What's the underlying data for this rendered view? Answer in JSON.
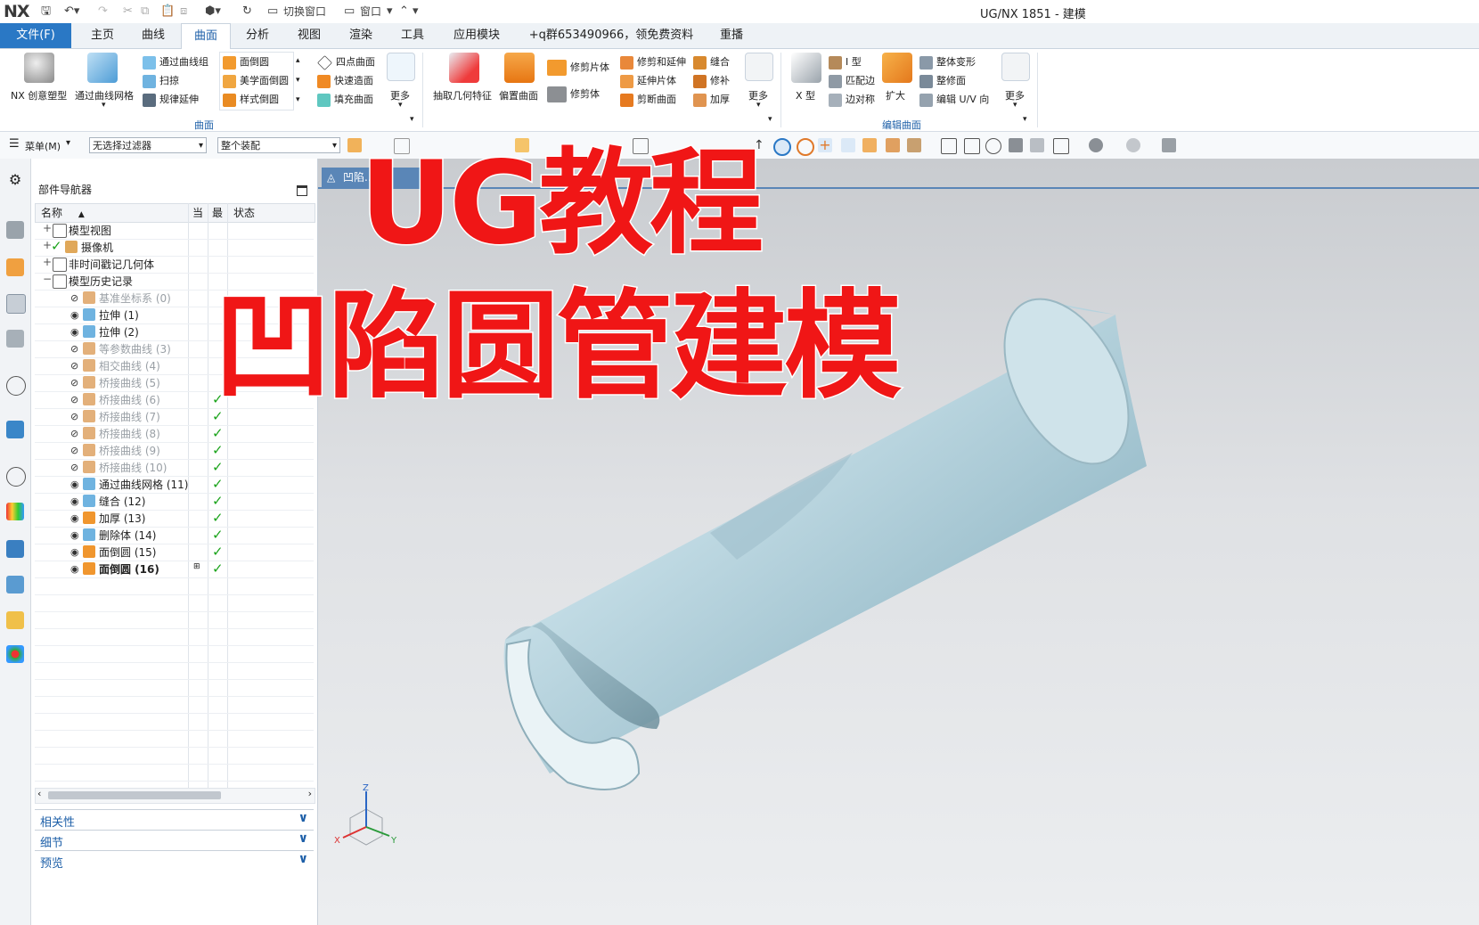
{
  "titlebar": {
    "logo": "NX",
    "switch_window": "切换窗口",
    "window_menu": "窗口",
    "title": "UG/NX 1851 - 建模"
  },
  "tabs": [
    "文件(F)",
    "主页",
    "曲线",
    "曲面",
    "分析",
    "视图",
    "渲染",
    "工具",
    "应用模块",
    "+q群653490966，领免费资料",
    "重播"
  ],
  "ribbon": {
    "surface_group": {
      "creative_modeling": "NX 创意塑型",
      "through_curve_mesh": "通过曲线网格",
      "through_curves": "通过曲线组",
      "sweep": "扫掠",
      "ruled": "规律延伸",
      "face_blend": "面倒圆",
      "aesthetic_blend": "美学面倒圆",
      "styled_blend": "样式倒圆",
      "four_point": "四点曲面",
      "quick_surface": "快速造面",
      "fill_surface": "填充曲面",
      "more": "更多",
      "label": "曲面"
    },
    "ops_group": {
      "extract_geometry": "抽取几何特征",
      "offset_surface": "偏置曲面",
      "trim_sheet": "修剪片体",
      "trim_body": "修剪体",
      "trim_extend": "修剪和延伸",
      "extend_sheet": "延伸片体",
      "split_surface": "剪断曲面",
      "sew": "缝合",
      "patch": "修补",
      "thicken": "加厚",
      "more": "更多"
    },
    "edit_group": {
      "x_form": "X 型",
      "i_form": "I 型",
      "match_edge": "匹配边",
      "edge_symmetry": "边对称",
      "enlarge": "扩大",
      "global_shaping": "整体变形",
      "refit": "整修面",
      "edit_uv": "编辑 U/V 向",
      "more": "更多",
      "label": "编辑曲面"
    }
  },
  "filterbar": {
    "menu": "菜单(M)",
    "filter": "无选择过滤器",
    "scope": "整个装配"
  },
  "navigator": {
    "title": "部件导航器",
    "columns": [
      "名称",
      "当",
      "最",
      "状态"
    ],
    "rows": [
      {
        "label": "模型视图",
        "style": "normal",
        "check": false
      },
      {
        "label": "摄像机",
        "style": "normal",
        "check": false
      },
      {
        "label": "非时间戳记几何体",
        "style": "normal",
        "check": false
      },
      {
        "label": "模型历史记录",
        "style": "normal",
        "check": false
      },
      {
        "label": "基准坐标系 (0)",
        "style": "grey",
        "check": false
      },
      {
        "label": "拉伸 (1)",
        "style": "normal",
        "check": false
      },
      {
        "label": "拉伸 (2)",
        "style": "normal",
        "check": false
      },
      {
        "label": "等参数曲线 (3)",
        "style": "grey",
        "check": false
      },
      {
        "label": "相交曲线 (4)",
        "style": "grey",
        "check": false
      },
      {
        "label": "桥接曲线 (5)",
        "style": "grey",
        "check": false
      },
      {
        "label": "桥接曲线 (6)",
        "style": "grey",
        "check": true
      },
      {
        "label": "桥接曲线 (7)",
        "style": "grey",
        "check": true
      },
      {
        "label": "桥接曲线 (8)",
        "style": "grey",
        "check": true
      },
      {
        "label": "桥接曲线 (9)",
        "style": "grey",
        "check": true
      },
      {
        "label": "桥接曲线 (10)",
        "style": "grey",
        "check": true
      },
      {
        "label": "通过曲线网格 (11)",
        "style": "normal",
        "check": true
      },
      {
        "label": "缝合 (12)",
        "style": "normal",
        "check": true
      },
      {
        "label": "加厚 (13)",
        "style": "normal",
        "check": true
      },
      {
        "label": "删除体 (14)",
        "style": "normal",
        "check": true
      },
      {
        "label": "面倒圆 (15)",
        "style": "normal",
        "check": true
      },
      {
        "label": "面倒圆 (16)",
        "style": "bold",
        "check": true
      }
    ],
    "panels": [
      "相关性",
      "细节",
      "预览"
    ]
  },
  "viewport": {
    "tab_label": "凹陷...rt",
    "overlay_line1": "UG教程",
    "overlay_line2": "凹陷圆管建模",
    "triad": {
      "z": "Z",
      "x": "X",
      "y": "Y"
    }
  },
  "colors": {
    "accent": "#2a78c5",
    "overlay_red": "#f01616",
    "check_green": "#1aa31a",
    "pipe": "#c4dde6"
  }
}
